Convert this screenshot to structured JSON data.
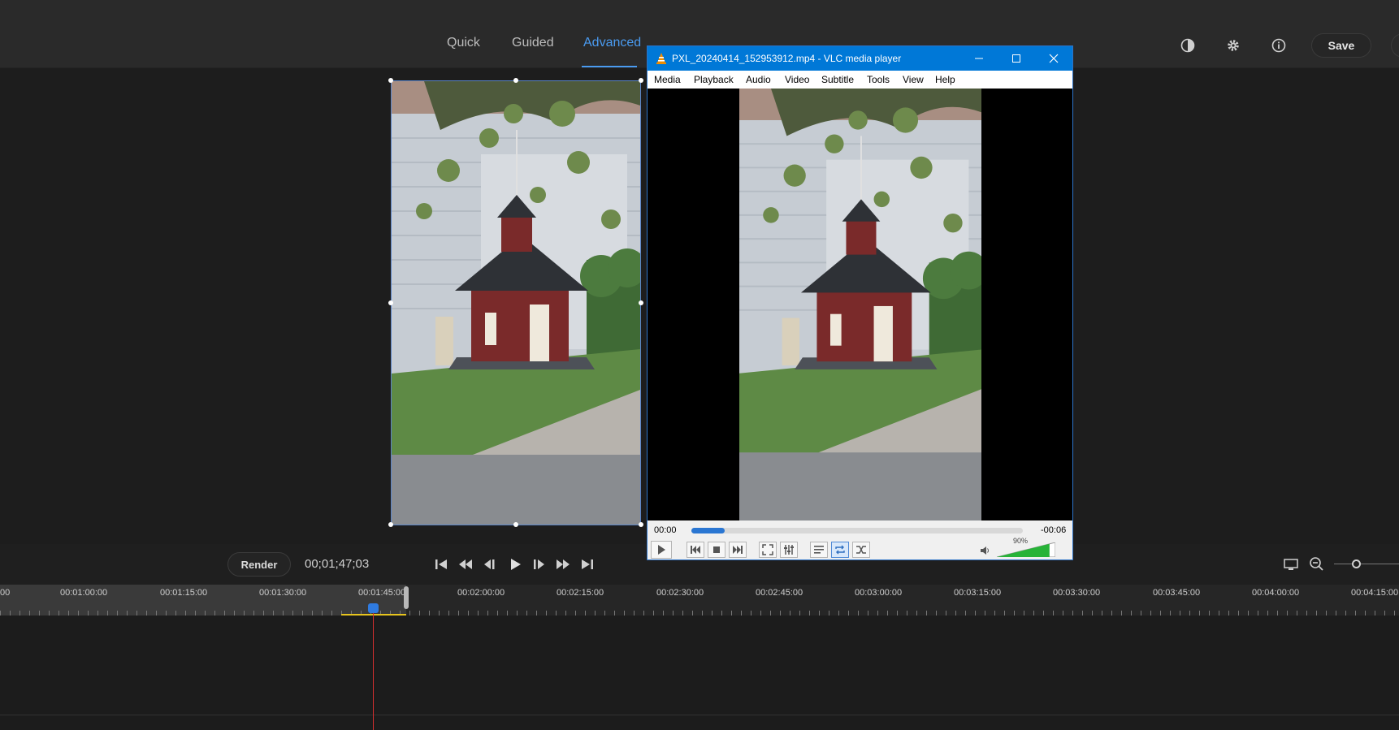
{
  "app": {
    "tabs": [
      {
        "label": "Quick",
        "active": false
      },
      {
        "label": "Guided",
        "active": false
      },
      {
        "label": "Advanced",
        "active": true
      }
    ],
    "toolbar_icons": [
      "contrast-icon",
      "gear-icon",
      "info-icon"
    ],
    "save_label": "Save",
    "accent": "#4a9bf0"
  },
  "transport": {
    "render_label": "Render",
    "timecode": "00;01;47;03",
    "buttons": [
      "skip-to-start-icon",
      "rewind-icon",
      "step-back-icon",
      "play-icon",
      "step-forward-icon",
      "fast-forward-icon",
      "skip-to-end-icon"
    ]
  },
  "timeline": {
    "labels": [
      "00",
      "00:01:00:00",
      "00:01:15:00",
      "00:01:30:00",
      "00:01:45:00",
      "00:02:00:00",
      "00:02:15:00",
      "00:02:30:00",
      "00:02:45:00",
      "00:03:00:00",
      "00:03:15:00",
      "00:03:30:00",
      "00:03:45:00",
      "00:04:00:00",
      "00:04:15:00"
    ]
  },
  "vlc": {
    "title": "PXL_20240414_152953912.mp4 - VLC media player",
    "menu": [
      "Media",
      "Playback",
      "Audio",
      "Video",
      "Subtitle",
      "Tools",
      "View",
      "Help"
    ],
    "elapsed": "00:00",
    "remaining": "-00:06",
    "progress": 0.1,
    "volume_label": "90%",
    "volume": 0.9,
    "title_color": "#0078d7"
  }
}
